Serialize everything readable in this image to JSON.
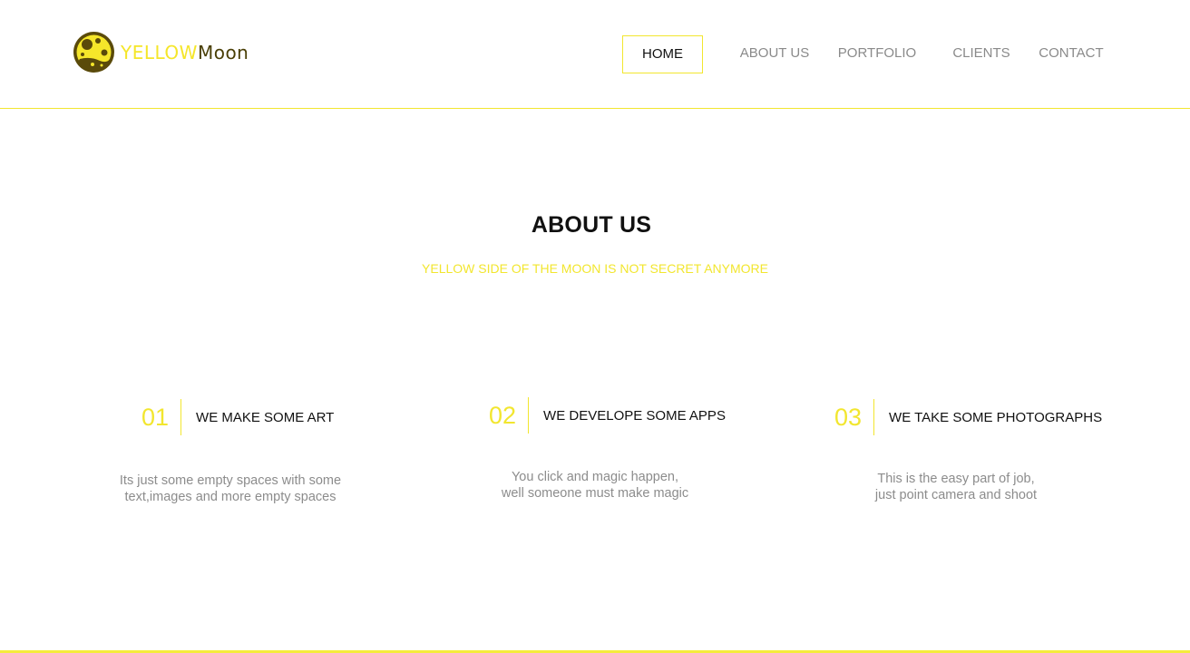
{
  "brand": {
    "name_part1": "YELLOW",
    "name_part2": "Moon",
    "logo_icon": "moon-logo-icon",
    "colors": {
      "accent": "#f2e62f",
      "dark": "#4a3f06"
    }
  },
  "nav": {
    "items": [
      {
        "label": "HOME",
        "active": true
      },
      {
        "label": "ABOUT US",
        "active": false
      },
      {
        "label": "PORTFOLIO",
        "active": false
      },
      {
        "label": "CLIENTS",
        "active": false
      },
      {
        "label": "CONTACT",
        "active": false
      }
    ]
  },
  "about": {
    "title": "ABOUT US",
    "subtitle": "YELLOW SIDE OF THE MOON IS NOT SECRET ANYMORE",
    "features": [
      {
        "number": "01",
        "title": "WE MAKE SOME ART",
        "description_lines": [
          "Its just some empty spaces with some",
          "text,images and more empty spaces"
        ]
      },
      {
        "number": "02",
        "title": "WE DEVELOPE SOME APPS",
        "description_lines": [
          "You click and magic happen,",
          "well someone must make magic"
        ]
      },
      {
        "number": "03",
        "title": "WE TAKE SOME PHOTOGRAPHS",
        "description_lines": [
          "This is the easy part of job,",
          "just point camera and shoot"
        ]
      }
    ]
  }
}
